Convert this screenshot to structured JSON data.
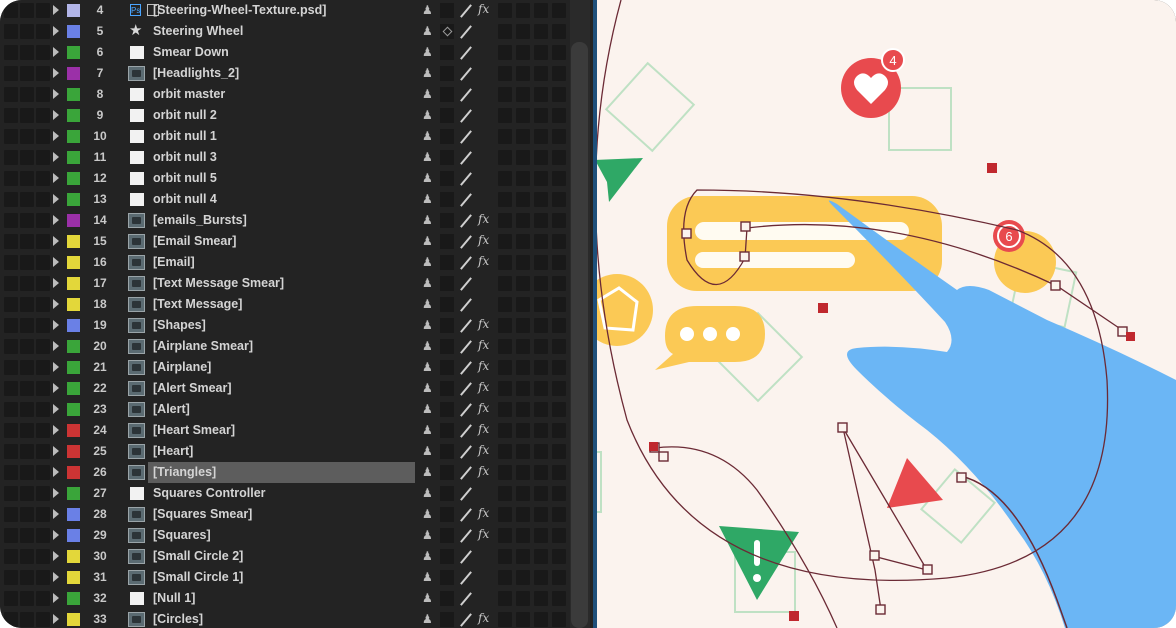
{
  "layers": [
    {
      "num": "4",
      "color": "#b2b5e8",
      "type": "psd",
      "name": "[Steering-Wheel-Texture.psd]",
      "fx": true
    },
    {
      "num": "5",
      "color": "#6a80e6",
      "type": "null",
      "name": "Steering Wheel",
      "fx": false,
      "diamond": true
    },
    {
      "num": "6",
      "color": "#3aa53a",
      "type": "solid",
      "name": "Smear Down",
      "fx": false
    },
    {
      "num": "7",
      "color": "#9b30a8",
      "type": "footage",
      "name": "[Headlights_2]",
      "fx": false
    },
    {
      "num": "8",
      "color": "#3aa53a",
      "type": "solid",
      "name": "orbit master",
      "fx": false
    },
    {
      "num": "9",
      "color": "#3aa53a",
      "type": "solid",
      "name": "orbit null 2",
      "fx": false
    },
    {
      "num": "10",
      "color": "#3aa53a",
      "type": "solid",
      "name": "orbit null 1",
      "fx": false
    },
    {
      "num": "11",
      "color": "#3aa53a",
      "type": "solid",
      "name": "orbit null 3",
      "fx": false
    },
    {
      "num": "12",
      "color": "#3aa53a",
      "type": "solid",
      "name": "orbit null 5",
      "fx": false
    },
    {
      "num": "13",
      "color": "#3aa53a",
      "type": "solid",
      "name": "orbit null 4",
      "fx": false
    },
    {
      "num": "14",
      "color": "#9b30a8",
      "type": "footage",
      "name": "[emails_Bursts]",
      "fx": true
    },
    {
      "num": "15",
      "color": "#e3d73a",
      "type": "footage",
      "name": "[Email Smear]",
      "fx": true
    },
    {
      "num": "16",
      "color": "#e3d73a",
      "type": "footage",
      "name": "[Email]",
      "fx": true
    },
    {
      "num": "17",
      "color": "#e3d73a",
      "type": "footage",
      "name": "[Text Message Smear]",
      "fx": false
    },
    {
      "num": "18",
      "color": "#e3d73a",
      "type": "footage",
      "name": "[Text Message]",
      "fx": false
    },
    {
      "num": "19",
      "color": "#6a80e6",
      "type": "footage",
      "name": "[Shapes]",
      "fx": true
    },
    {
      "num": "20",
      "color": "#3aa53a",
      "type": "footage",
      "name": "[Airplane Smear]",
      "fx": true
    },
    {
      "num": "21",
      "color": "#3aa53a",
      "type": "footage",
      "name": "[Airplane]",
      "fx": true
    },
    {
      "num": "22",
      "color": "#3aa53a",
      "type": "footage",
      "name": "[Alert Smear]",
      "fx": true
    },
    {
      "num": "23",
      "color": "#3aa53a",
      "type": "footage",
      "name": "[Alert]",
      "fx": true
    },
    {
      "num": "24",
      "color": "#cc3434",
      "type": "footage",
      "name": "[Heart Smear]",
      "fx": true
    },
    {
      "num": "25",
      "color": "#cc3434",
      "type": "footage",
      "name": "[Heart]",
      "fx": true
    },
    {
      "num": "26",
      "color": "#cc3434",
      "type": "footage",
      "name": "[Triangles]",
      "fx": true,
      "selected": true
    },
    {
      "num": "27",
      "color": "#3aa53a",
      "type": "solid",
      "name": "Squares Controller",
      "fx": false
    },
    {
      "num": "28",
      "color": "#6a80e6",
      "type": "footage",
      "name": "[Squares Smear]",
      "fx": true
    },
    {
      "num": "29",
      "color": "#6a80e6",
      "type": "footage",
      "name": "[Squares]",
      "fx": true
    },
    {
      "num": "30",
      "color": "#e3d73a",
      "type": "footage",
      "name": "[Small Circle 2]",
      "fx": false
    },
    {
      "num": "31",
      "color": "#e3d73a",
      "type": "footage",
      "name": "[Small Circle 1]",
      "fx": false
    },
    {
      "num": "32",
      "color": "#3aa53a",
      "type": "solid",
      "name": "[Null 1]",
      "fx": false
    },
    {
      "num": "33",
      "color": "#e3d73a",
      "type": "footage",
      "name": "[Circles]",
      "fx": true
    }
  ],
  "icons": {
    "shy": "shy-icon",
    "switch": "quality-switch-icon",
    "fx": "fx-icon",
    "twirl": "twirl-triangle-icon"
  },
  "fx_label": "fx",
  "shy_glyph": "♟",
  "canvas": {
    "heart_badge": "4",
    "notification_badge": "6",
    "colors": {
      "bubble": "#fbc955",
      "hand": "#6bb6f5",
      "green": "#2fa866",
      "red": "#e84a4e",
      "path": "#6b2a35"
    }
  }
}
